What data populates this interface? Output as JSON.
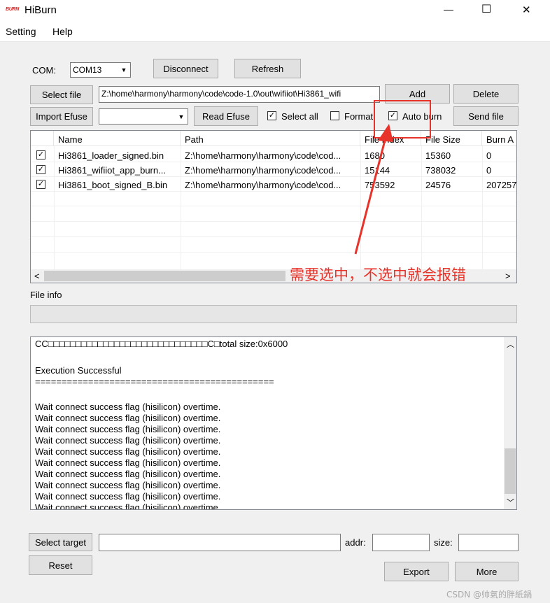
{
  "window": {
    "logo_text": "BURN",
    "title": "HiBurn",
    "minimize_glyph": "—",
    "maximize_glyph": "☐",
    "close_glyph": "✕"
  },
  "menu": [
    "Setting",
    "Help"
  ],
  "com": {
    "label": "COM:",
    "value": "COM13",
    "disconnect": "Disconnect",
    "refresh": "Refresh"
  },
  "file_row": {
    "select_file": "Select file",
    "path": "Z:\\home\\harmony\\harmony\\code\\code-1.0\\out\\wifiiot\\Hi3861_wifi",
    "add": "Add",
    "delete": "Delete"
  },
  "efuse_row": {
    "import_efuse": "Import Efuse",
    "efuse_value": "",
    "read_efuse": "Read Efuse",
    "select_all": "Select all",
    "select_all_checked": true,
    "format": "Format",
    "format_checked": false,
    "auto_burn": "Auto burn",
    "auto_burn_checked": true,
    "send_file": "Send file"
  },
  "table": {
    "columns": [
      "Name",
      "Path",
      "File Index",
      "File Size",
      "Burn A"
    ],
    "rows": [
      {
        "checked": true,
        "name": "Hi3861_loader_signed.bin",
        "path": "Z:\\home\\harmony\\harmony\\code\\cod...",
        "index": "1680",
        "size": "15360",
        "burn": "0"
      },
      {
        "checked": true,
        "name": "Hi3861_wifiiot_app_burn...",
        "path": "Z:\\home\\harmony\\harmony\\code\\cod...",
        "index": "15144",
        "size": "738032",
        "burn": "0"
      },
      {
        "checked": true,
        "name": "Hi3861_boot_signed_B.bin",
        "path": "Z:\\home\\harmony\\harmony\\code\\cod...",
        "index": "753592",
        "size": "24576",
        "burn": "207257"
      }
    ]
  },
  "annotation": {
    "text": "需要选中，不选中就会报错",
    "color": "#e8332a"
  },
  "file_info": {
    "label": "File info",
    "value": ""
  },
  "log": {
    "lines": [
      "CC□□□□□□□□□□□□□□□□□□□□□□□□□□□□□C□total size:0x6000",
      "",
      "Execution Successful",
      "=============================================",
      "",
      "Wait connect success flag (hisilicon) overtime.",
      "Wait connect success flag (hisilicon) overtime.",
      "Wait connect success flag (hisilicon) overtime.",
      "Wait connect success flag (hisilicon) overtime.",
      "Wait connect success flag (hisilicon) overtime.",
      "Wait connect success flag (hisilicon) overtime.",
      "Wait connect success flag (hisilicon) overtime.",
      "Wait connect success flag (hisilicon) overtime.",
      "Wait connect success flag (hisilicon) overtime.",
      "Wait connect success flag (hisilicon) overtime."
    ]
  },
  "bottom": {
    "select_target": "Select target",
    "target_value": "",
    "addr_label": "addr:",
    "addr_value": "",
    "size_label": "size:",
    "size_value": "",
    "reset": "Reset",
    "export": "Export",
    "more": "More"
  },
  "watermark": "CSDN @帅氣的胖紙鍋"
}
